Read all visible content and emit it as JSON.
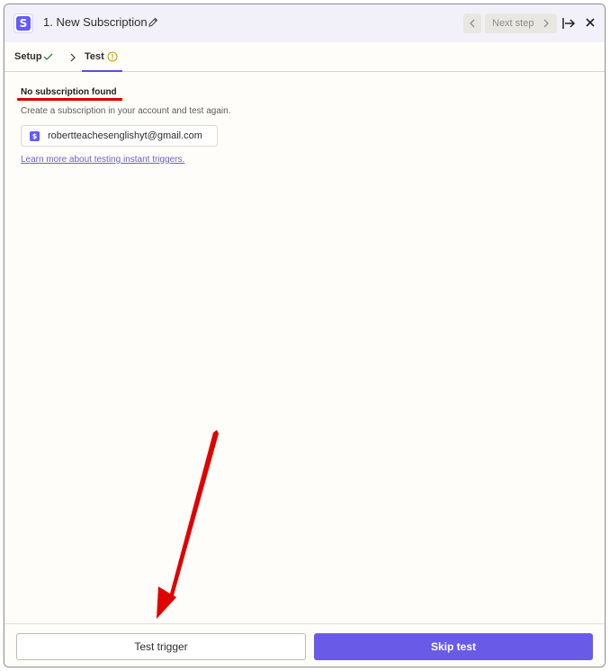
{
  "header": {
    "app_logo_letter": "S",
    "step_title": "1. New Subscription",
    "prev_icon": "chevron-left-icon",
    "next_step_label": "Next step",
    "next_icon": "chevron-right-icon",
    "collapse_icon": "collapse-panel-icon",
    "close_icon": "close-icon"
  },
  "tabs": {
    "setup_label": "Setup",
    "setup_status_icon": "check-icon",
    "separator_icon": "chevron-right-icon",
    "test_label": "Test",
    "test_status_icon": "warning-icon"
  },
  "content": {
    "heading": "No subscription found",
    "description": "Create a subscription in your account and test again.",
    "account": {
      "logo_letter": "$",
      "email": "robertteachesenglishyt@gmail.com"
    },
    "learn_link": "Learn more about testing instant triggers."
  },
  "footer": {
    "test_trigger_label": "Test trigger",
    "skip_test_label": "Skip test"
  },
  "colors": {
    "accent": "#695be8",
    "header_bg": "#f2f1f9",
    "annotation_red": "#e00000",
    "check_green": "#2e8b3c",
    "warning_yellow": "#c9a100"
  }
}
